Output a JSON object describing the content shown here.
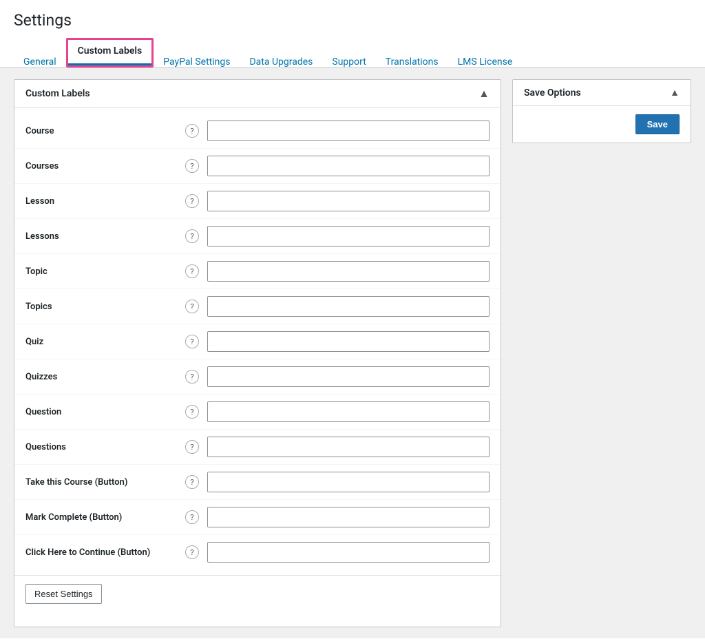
{
  "page": {
    "title": "Settings"
  },
  "tabs": [
    {
      "id": "general",
      "label": "General",
      "active": false
    },
    {
      "id": "custom-labels",
      "label": "Custom Labels",
      "active": true
    },
    {
      "id": "paypal-settings",
      "label": "PayPal Settings",
      "active": false
    },
    {
      "id": "data-upgrades",
      "label": "Data Upgrades",
      "active": false
    },
    {
      "id": "support",
      "label": "Support",
      "active": false
    },
    {
      "id": "translations",
      "label": "Translations",
      "active": false
    },
    {
      "id": "lms-license",
      "label": "LMS License",
      "active": false
    }
  ],
  "main_panel": {
    "title": "Custom Labels",
    "toggle_icon": "▲"
  },
  "form_fields": [
    {
      "id": "course",
      "label": "Course",
      "value": "",
      "placeholder": ""
    },
    {
      "id": "courses",
      "label": "Courses",
      "value": "",
      "placeholder": ""
    },
    {
      "id": "lesson",
      "label": "Lesson",
      "value": "",
      "placeholder": ""
    },
    {
      "id": "lessons",
      "label": "Lessons",
      "value": "",
      "placeholder": ""
    },
    {
      "id": "topic",
      "label": "Topic",
      "value": "",
      "placeholder": ""
    },
    {
      "id": "topics",
      "label": "Topics",
      "value": "",
      "placeholder": ""
    },
    {
      "id": "quiz",
      "label": "Quiz",
      "value": "",
      "placeholder": ""
    },
    {
      "id": "quizzes",
      "label": "Quizzes",
      "value": "",
      "placeholder": ""
    },
    {
      "id": "question",
      "label": "Question",
      "value": "",
      "placeholder": ""
    },
    {
      "id": "questions",
      "label": "Questions",
      "value": "",
      "placeholder": ""
    },
    {
      "id": "take-this-course-button",
      "label": "Take this Course (Button)",
      "value": "",
      "placeholder": ""
    },
    {
      "id": "mark-complete-button",
      "label": "Mark Complete (Button)",
      "value": "",
      "placeholder": ""
    },
    {
      "id": "click-here-to-continue-button",
      "label": "Click Here to Continue (Button)",
      "value": "",
      "placeholder": ""
    }
  ],
  "footer": {
    "reset_label": "Reset Settings"
  },
  "sidebar": {
    "save_options_title": "Save Options",
    "toggle_icon": "▲",
    "save_label": "Save"
  },
  "icons": {
    "help": "?",
    "chevron_up": "▲"
  }
}
